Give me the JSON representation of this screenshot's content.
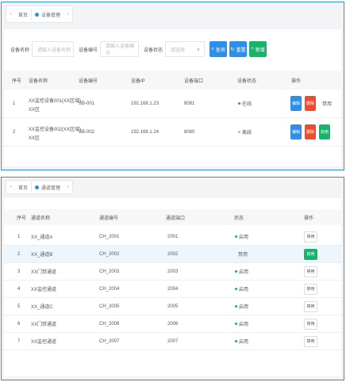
{
  "tabs_top": {
    "home_label": "首页",
    "active_tab": "设备管理"
  },
  "filters": {
    "name_label": "设备名称",
    "name_placeholder": "请输入设备名称",
    "code_label": "设备编号",
    "code_placeholder": "请输入设备编号",
    "status_label": "设备状态",
    "status_value": "请选择",
    "query_label": "查询",
    "reset_label": "重置",
    "add_label": "新增"
  },
  "table1": {
    "headers": [
      "序号",
      "设备名称",
      "设备编号",
      "设备IP",
      "设备端口",
      "设备状态",
      "操作"
    ],
    "rows": [
      {
        "no": "1",
        "name": "XX监控设备001(XX区域)",
        "name2": "XX区",
        "code": "SB-001",
        "ip": "192.168.1.23",
        "port": "8081",
        "status": "在线",
        "status_color": "#16b56a",
        "actions": [
          "编辑",
          "删除",
          "禁用"
        ]
      },
      {
        "no": "2",
        "name": "XX监控设备002(XX区域)",
        "name2": "XX区",
        "code": "SB-002",
        "ip": "192.168.1.24",
        "port": "8080",
        "status": "离线",
        "status_color": "#bbbbbb",
        "actions": [
          "编辑",
          "删除",
          "启用"
        ]
      }
    ]
  },
  "tabs_bottom": {
    "home_label": "首页",
    "active_tab": "通道管理"
  },
  "table2": {
    "headers": [
      "序号",
      "通道名称",
      "通道编号",
      "通道端口",
      "状态",
      "操作"
    ],
    "rows": [
      {
        "no": "1",
        "name": "XX_通道A",
        "code": "CH_2001",
        "port": "2001",
        "status": "启用",
        "status_color": "#16b56a",
        "action": "禁用",
        "selected": false
      },
      {
        "no": "2",
        "name": "XX_通道B",
        "code": "CH_2002",
        "port": "2002",
        "status": "禁用",
        "status_color": "",
        "action": "启用",
        "selected": true
      },
      {
        "no": "3",
        "name": "XX门禁通道",
        "code": "CH_2003",
        "port": "2003",
        "status": "启用",
        "status_color": "#16b56a",
        "action": "禁用",
        "selected": false
      },
      {
        "no": "4",
        "name": "XX监控通道",
        "code": "CH_2004",
        "port": "2004",
        "status": "启用",
        "status_color": "#16b56a",
        "action": "禁用",
        "selected": false
      },
      {
        "no": "5",
        "name": "XX_通道C",
        "code": "CH_2005",
        "port": "2005",
        "status": "启用",
        "status_color": "#16b56a",
        "action": "禁用",
        "selected": false
      },
      {
        "no": "6",
        "name": "XX门禁通道",
        "code": "CH_2006",
        "port": "2006",
        "status": "启用",
        "status_color": "#16b56a",
        "action": "禁用",
        "selected": false
      },
      {
        "no": "7",
        "name": "XX监控通道",
        "code": "CH_2007",
        "port": "2007",
        "status": "启用",
        "status_color": "#16b56a",
        "action": "禁用",
        "selected": false
      }
    ]
  }
}
